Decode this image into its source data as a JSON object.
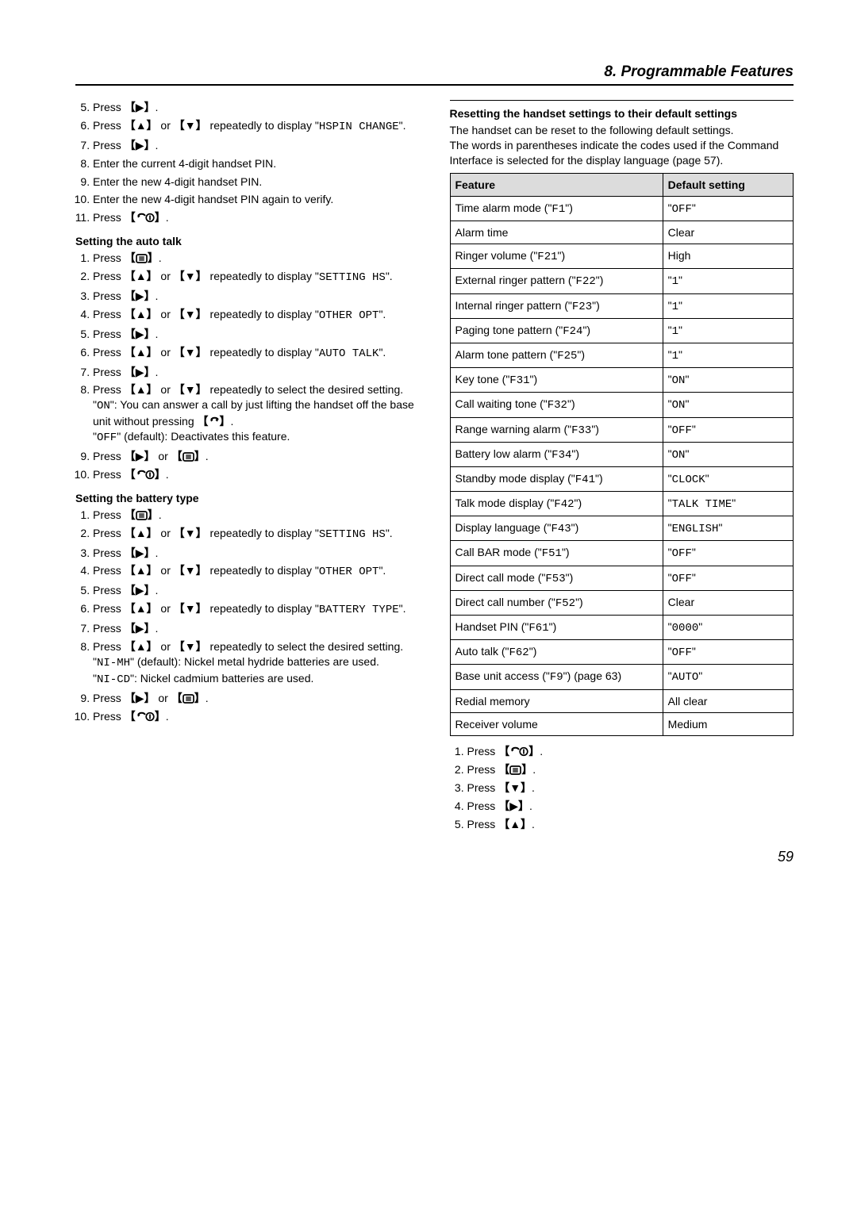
{
  "header": {
    "title": "8. Programmable Features"
  },
  "left": {
    "steps_top": [
      "Press __RIGHT__.",
      "Press __UP__ or __DOWN__ repeatedly to display \"__MONO__HSPIN CHANGE__\".",
      "Press __RIGHT__.",
      "Enter the current 4-digit handset PIN.",
      "Enter the new 4-digit handset PIN.",
      "Enter the new 4-digit handset PIN again to verify.",
      "Press __HANGUP__."
    ],
    "steps_top_start": 5,
    "section_auto_talk": "Setting the auto talk",
    "steps_auto_talk": [
      "Press __MENU__.",
      "Press __UP__ or __DOWN__ repeatedly to display \"__MONO__SETTING HS__\".",
      "Press __RIGHT__.",
      "Press __UP__ or __DOWN__ repeatedly to display \"__MONO__OTHER OPT__\".",
      "Press __RIGHT__.",
      "Press __UP__ or __DOWN__ repeatedly to display \"__MONO__AUTO TALK__\".",
      "Press __RIGHT__.",
      "Press __UP__ or __DOWN__ repeatedly to select the desired setting.\n\"__MONO__ON__\": You can answer a call by just lifting the handset off the base unit without pressing __TALK__.\n\"__MONO__OFF__\" (default): Deactivates this feature.",
      "Press __RIGHT__ or __MENU__.",
      "Press __HANGUP__."
    ],
    "section_battery": "Setting the battery type",
    "steps_battery": [
      "Press __MENU__.",
      "Press __UP__ or __DOWN__ repeatedly to display \"__MONO__SETTING HS__\".",
      "Press __RIGHT__.",
      "Press __UP__ or __DOWN__ repeatedly to display \"__MONO__OTHER OPT__\".",
      "Press __RIGHT__.",
      "Press __UP__ or __DOWN__ repeatedly to display \"__MONO__BATTERY TYPE__\".",
      "Press __RIGHT__.",
      "Press __UP__ or __DOWN__ repeatedly to select the desired setting.\n\"__MONO__NI-MH__\" (default): Nickel metal hydride batteries are used.\n\"__MONO__NI-CD__\": Nickel cadmium batteries are used.",
      "Press __RIGHT__ or __MENU__.",
      "Press __HANGUP__."
    ]
  },
  "right": {
    "section_reset_title": "Resetting the handset settings to their default settings",
    "reset_para1": "The handset can be reset to the following default settings.",
    "reset_para2": "The words in parentheses indicate the codes used if the Command Interface is selected for the display language (page 57).",
    "table_headers": [
      "Feature",
      "Default setting"
    ],
    "table_rows": [
      [
        "Time alarm mode (\"__MONO__F1__\")",
        "\"__MONO__OFF__\""
      ],
      [
        "Alarm time",
        "Clear"
      ],
      [
        "Ringer volume (\"__MONO__F21__\")",
        "High"
      ],
      [
        "External ringer pattern (\"__MONO__F22__\")",
        "\"__MONO__1__\""
      ],
      [
        "Internal ringer pattern (\"__MONO__F23__\")",
        "\"__MONO__1__\""
      ],
      [
        "Paging tone pattern (\"__MONO__F24__\")",
        "\"__MONO__1__\""
      ],
      [
        "Alarm tone pattern (\"__MONO__F25__\")",
        "\"__MONO__1__\""
      ],
      [
        "Key tone (\"__MONO__F31__\")",
        "\"__MONO__ON__\""
      ],
      [
        "Call waiting tone (\"__MONO__F32__\")",
        "\"__MONO__ON__\""
      ],
      [
        "Range warning alarm (\"__MONO__F33__\")",
        "\"__MONO__OFF__\""
      ],
      [
        "Battery low alarm (\"__MONO__F34__\")",
        "\"__MONO__ON__\""
      ],
      [
        "Standby mode display (\"__MONO__F41__\")",
        "\"__MONO__CLOCK__\""
      ],
      [
        "Talk mode display (\"__MONO__F42__\")",
        "\"__MONO__TALK TIME__\""
      ],
      [
        "Display language (\"__MONO__F43__\")",
        "\"__MONO__ENGLISH__\""
      ],
      [
        "Call BAR mode (\"__MONO__F51__\")",
        "\"__MONO__OFF__\""
      ],
      [
        "Direct call mode (\"__MONO__F53__\")",
        "\"__MONO__OFF__\""
      ],
      [
        "Direct call number (\"__MONO__F52__\")",
        "Clear"
      ],
      [
        "Handset PIN (\"__MONO__F61__\")",
        "\"__MONO__0000__\""
      ],
      [
        "Auto talk (\"__MONO__F62__\")",
        "\"__MONO__OFF__\""
      ],
      [
        "Base unit access (\"__MONO__F9__\") (page 63)",
        "\"__MONO__AUTO__\""
      ],
      [
        "Redial memory",
        "All clear"
      ],
      [
        "Receiver volume",
        "Medium"
      ]
    ],
    "steps_reset": [
      "Press __HANGUP__.",
      "Press __MENU__.",
      "Press __DOWNBTN__.",
      "Press __RIGHT__.",
      "Press __UPBTN__."
    ]
  },
  "page_number": "59"
}
